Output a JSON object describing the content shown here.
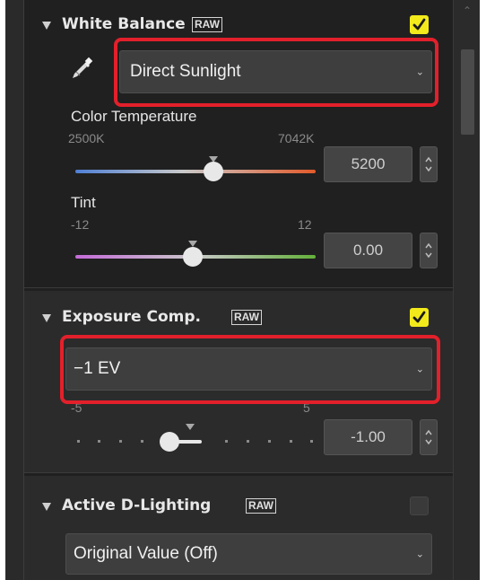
{
  "colors": {
    "highlight": "#e2202b",
    "checkbox_on": "#f2ea1b",
    "panel_bg": "#202020"
  },
  "white_balance": {
    "title": "White Balance",
    "raw_badge": "RAW",
    "enabled": true,
    "eyedropper_icon": "eyedropper-icon",
    "mode_value": "Direct Sunlight",
    "color_temperature": {
      "label": "Color Temperature",
      "min_label": "2500K",
      "max_label": "7042K",
      "value": "5200",
      "fraction": 0.33
    },
    "tint": {
      "label": "Tint",
      "min_label": "-12",
      "max_label": "12",
      "value": "0.00",
      "fraction": 0.5
    }
  },
  "exposure_comp": {
    "title": "Exposure Comp.",
    "raw_badge": "RAW",
    "enabled": true,
    "mode_value": "−1 EV",
    "slider": {
      "min_label": "-5",
      "max_label": "5",
      "value": "-1.00",
      "fraction": 0.4
    }
  },
  "active_d_lighting": {
    "title": "Active D-Lighting",
    "raw_badge": "RAW",
    "enabled": false,
    "mode_value": "Original Value (Off)"
  }
}
